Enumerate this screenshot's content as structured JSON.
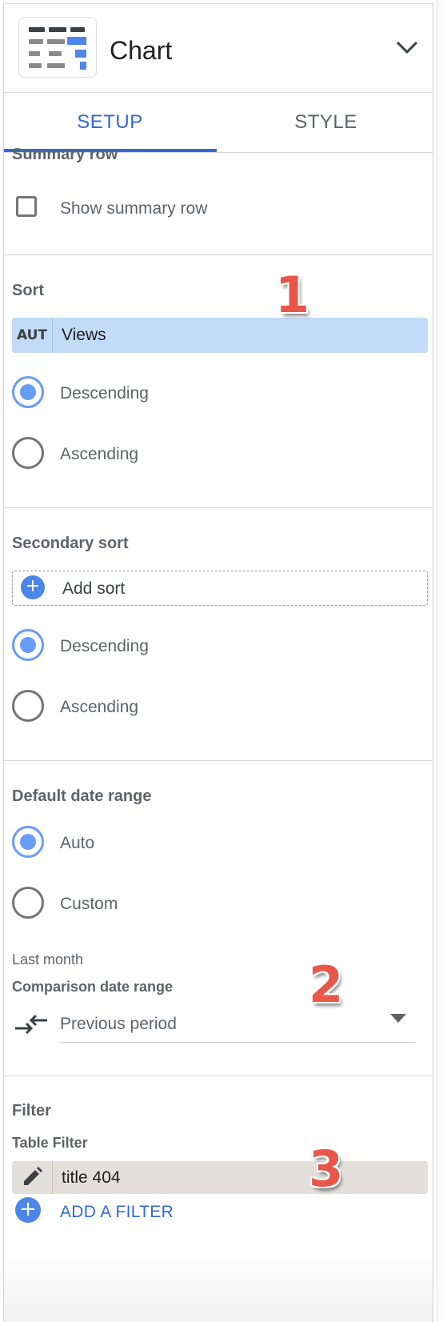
{
  "header": {
    "title": "Chart",
    "chevron_icon": "chevron-down-icon",
    "thumbnail_icon": "table-chart-icon"
  },
  "tabs": [
    {
      "label": "SETUP",
      "active": true
    },
    {
      "label": "STYLE",
      "active": false
    }
  ],
  "summary_row": {
    "title": "Summary row",
    "checkbox_label": "Show summary row",
    "checked": false
  },
  "sort": {
    "title": "Sort",
    "field": {
      "tag": "AUT",
      "value": "Views"
    },
    "options": [
      {
        "label": "Descending",
        "selected": true
      },
      {
        "label": "Ascending",
        "selected": false
      }
    ]
  },
  "secondary_sort": {
    "title": "Secondary sort",
    "add_label": "Add sort",
    "options": [
      {
        "label": "Descending",
        "selected": true
      },
      {
        "label": "Ascending",
        "selected": false
      }
    ]
  },
  "date_range": {
    "title": "Default date range",
    "options": [
      {
        "label": "Auto",
        "selected": true
      },
      {
        "label": "Custom",
        "selected": false
      }
    ],
    "current_label": "Last month",
    "comparison_title": "Comparison date range",
    "comparison_value": "Previous period"
  },
  "filter": {
    "title": "Filter",
    "subtitle": "Table Filter",
    "item": "title 404",
    "add_label": "ADD A FILTER"
  },
  "annotations": {
    "one": "1",
    "two": "2",
    "three": "3"
  },
  "colors": {
    "accent": "#3367d6",
    "radio": "#669df6",
    "sort_field": "#c2dbf7",
    "badge": "#e9574a"
  }
}
